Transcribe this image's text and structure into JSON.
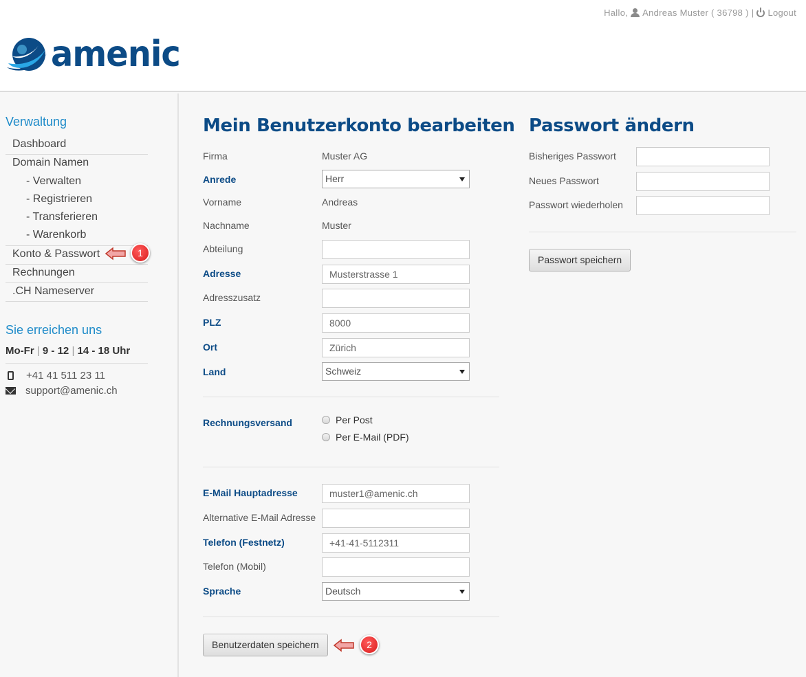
{
  "topbar": {
    "greeting": "Hallo,",
    "user": "Andreas Muster ( 36798 )",
    "separator": "|",
    "logout": "Logout"
  },
  "brand": {
    "name": "amenic"
  },
  "sidebar": {
    "heading": "Verwaltung",
    "items": [
      {
        "label": "Dashboard"
      },
      {
        "label": "Domain Namen"
      },
      {
        "label": "- Verwalten"
      },
      {
        "label": "- Registrieren"
      },
      {
        "label": "- Transferieren"
      },
      {
        "label": "- Warenkorb"
      },
      {
        "label": "Konto & Passwort"
      },
      {
        "label": "Rechnungen"
      },
      {
        "label": ".CH Nameserver"
      }
    ],
    "contact_heading": "Sie erreichen uns",
    "hours": {
      "days": "Mo-Fr",
      "sep": "|",
      "slot1": "9 - 12",
      "slot2": "14 - 18 Uhr"
    },
    "phone": "+41 41 511 23 11",
    "email": "support@amenic.ch"
  },
  "annotations": {
    "badge1": "1",
    "badge2": "2"
  },
  "account": {
    "title": "Mein Benutzerkonto bearbeiten",
    "firma_label": "Firma",
    "firma_value": "Muster AG",
    "anrede_label": "Anrede",
    "anrede_value": "Herr",
    "vorname_label": "Vorname",
    "vorname_value": "Andreas",
    "nachname_label": "Nachname",
    "nachname_value": "Muster",
    "abteilung_label": "Abteilung",
    "abteilung_value": "",
    "adresse_label": "Adresse",
    "adresse_value": "Musterstrasse 1",
    "adresszusatz_label": "Adresszusatz",
    "adresszusatz_value": "",
    "plz_label": "PLZ",
    "plz_value": "8000",
    "ort_label": "Ort",
    "ort_value": "Zürich",
    "land_label": "Land",
    "land_value": "Schweiz",
    "versand_label": "Rechnungsversand",
    "versand_options": [
      "Per Post",
      "Per E-Mail (PDF)"
    ],
    "email_label": "E-Mail Hauptadresse",
    "email_value": "muster1@amenic.ch",
    "alt_email_label": "Alternative E-Mail Adresse",
    "alt_email_value": "",
    "tel_label": "Telefon (Festnetz)",
    "tel_value": "+41-41-5112311",
    "mobil_label": "Telefon (Mobil)",
    "mobil_value": "",
    "sprache_label": "Sprache",
    "sprache_value": "Deutsch",
    "save_button": "Benutzerdaten speichern"
  },
  "password": {
    "title": "Passwort ändern",
    "old_label": "Bisheriges Passwort",
    "new_label": "Neues Passwort",
    "repeat_label": "Passwort wiederholen",
    "save_button": "Passwort speichern"
  }
}
